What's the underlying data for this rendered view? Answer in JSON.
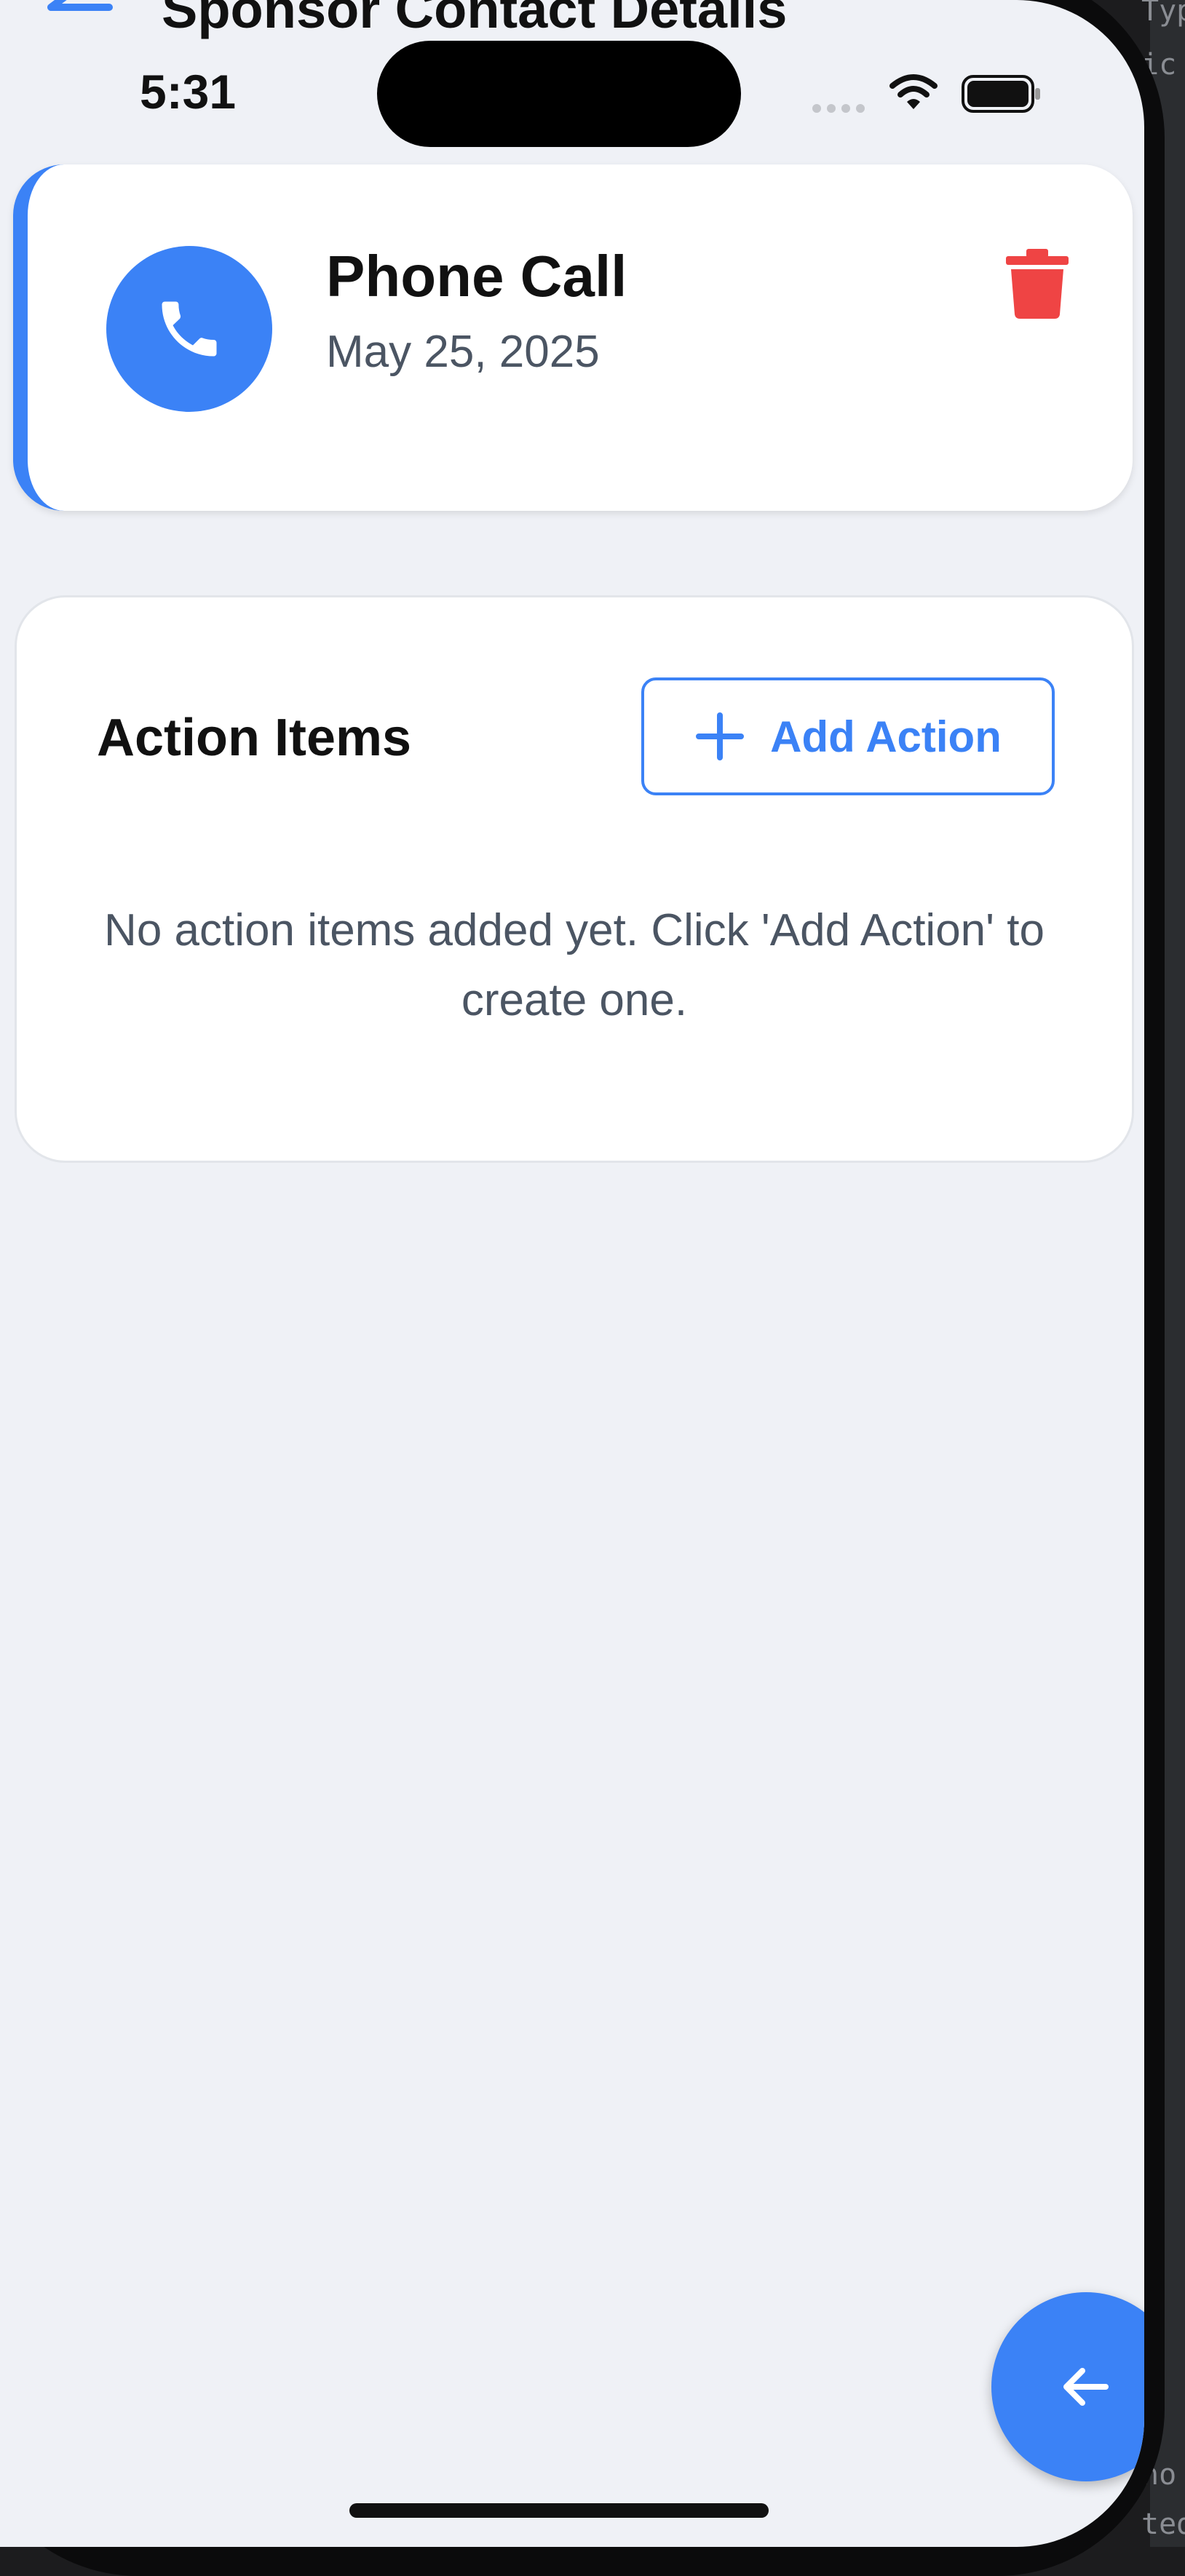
{
  "nav": {
    "title": "Sponsor Contact Details",
    "back_icon": "arrow-left-icon"
  },
  "status_bar": {
    "time": "5:31",
    "icons": [
      "cellular-signal-icon",
      "wifi-icon",
      "battery-icon"
    ]
  },
  "contact": {
    "type": "Phone Call",
    "date": "May 25, 2025",
    "icon": "phone-icon",
    "delete_icon": "trash-icon",
    "accent_color": "#3b82f6",
    "delete_color": "#ef4444"
  },
  "action_items": {
    "title": "Action Items",
    "add_button_label": "Add Action",
    "add_icon": "plus-icon",
    "empty_message": "No action items added yet. Click 'Add Action' to create one."
  },
  "fab": {
    "icon": "arrow-left-icon"
  },
  "ide_fragments": [
    "Typ",
    "ic",
    "ho",
    "tedA"
  ]
}
